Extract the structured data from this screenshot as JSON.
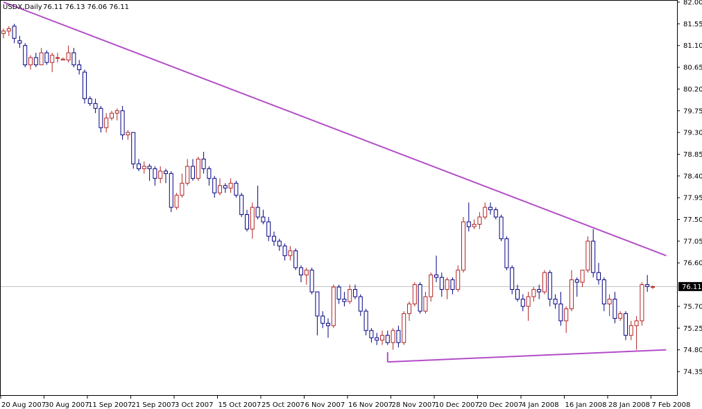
{
  "chart_data": {
    "type": "candlestick",
    "title": "USDX,Daily",
    "ohlc_header": "76.11 76.13 76.06 76.11",
    "ylim": [
      74.35,
      82.0
    ],
    "y_ticks": [
      "82.00",
      "81.55",
      "81.10",
      "80.65",
      "80.20",
      "79.75",
      "79.30",
      "78.85",
      "78.40",
      "77.95",
      "77.50",
      "77.05",
      "76.60",
      "76.11",
      "75.70",
      "75.25",
      "74.80",
      "74.35"
    ],
    "x_ticks": [
      "20 Aug 2007",
      "30 Aug 2007",
      "11 Sep 2007",
      "21 Sep 2007",
      "3 Oct 2007",
      "15 Oct 2007",
      "25 Oct 2007",
      "6 Nov 2007",
      "16 Nov 2007",
      "28 Nov 2007",
      "10 Dec 2007",
      "20 Dec 2007",
      "4 Jan 2008",
      "16 Jan 2008",
      "28 Jan 2008",
      "7 Feb 2008"
    ],
    "current_price": "76.11",
    "colors": {
      "background": "#ffffff",
      "axis": "#000000",
      "bull": "#b22222",
      "bear": "#000080",
      "trendline": "#b34dc8",
      "price_line": "#c0c0c0"
    },
    "candles": [
      [
        81.35,
        81.45,
        81.25,
        81.4
      ],
      [
        81.4,
        81.5,
        81.3,
        81.45
      ],
      [
        81.5,
        81.55,
        81.15,
        81.25
      ],
      [
        81.2,
        81.3,
        81.05,
        81.15
      ],
      [
        81.1,
        81.15,
        80.65,
        80.7
      ],
      [
        80.7,
        80.9,
        80.6,
        80.85
      ],
      [
        80.85,
        80.95,
        80.65,
        80.7
      ],
      [
        80.7,
        81.05,
        80.7,
        80.95
      ],
      [
        80.95,
        81.0,
        80.7,
        80.75
      ],
      [
        80.75,
        80.95,
        80.55,
        80.9
      ],
      [
        80.85,
        80.95,
        80.75,
        80.85
      ],
      [
        80.8,
        80.85,
        80.8,
        80.82
      ],
      [
        80.8,
        81.1,
        80.75,
        80.95
      ],
      [
        80.95,
        81.05,
        80.65,
        80.7
      ],
      [
        80.7,
        80.8,
        80.5,
        80.6
      ],
      [
        80.55,
        80.6,
        79.9,
        80.0
      ],
      [
        80.0,
        80.05,
        79.85,
        79.9
      ],
      [
        79.9,
        80.0,
        79.7,
        79.8
      ],
      [
        79.8,
        79.85,
        79.3,
        79.4
      ],
      [
        79.4,
        79.7,
        79.3,
        79.6
      ],
      [
        79.6,
        79.75,
        79.55,
        79.7
      ],
      [
        79.7,
        79.8,
        79.55,
        79.75
      ],
      [
        79.75,
        79.85,
        79.15,
        79.25
      ],
      [
        79.25,
        79.35,
        79.15,
        79.3
      ],
      [
        79.3,
        79.3,
        78.55,
        78.65
      ],
      [
        78.65,
        78.75,
        78.5,
        78.55
      ],
      [
        78.55,
        78.7,
        78.45,
        78.6
      ],
      [
        78.6,
        78.65,
        78.3,
        78.55
      ],
      [
        78.55,
        78.6,
        78.2,
        78.35
      ],
      [
        78.35,
        78.6,
        78.25,
        78.5
      ],
      [
        78.5,
        78.55,
        78.25,
        78.45
      ],
      [
        78.45,
        78.5,
        77.65,
        77.75
      ],
      [
        77.75,
        78.05,
        77.7,
        78.0
      ],
      [
        78.0,
        78.45,
        77.95,
        78.25
      ],
      [
        78.25,
        78.75,
        78.2,
        78.6
      ],
      [
        78.6,
        78.75,
        78.3,
        78.35
      ],
      [
        78.35,
        78.8,
        78.3,
        78.75
      ],
      [
        78.75,
        78.9,
        78.45,
        78.55
      ],
      [
        78.55,
        78.6,
        78.2,
        78.35
      ],
      [
        78.35,
        78.4,
        77.95,
        78.05
      ],
      [
        78.05,
        78.35,
        78.0,
        78.2
      ],
      [
        78.2,
        78.25,
        78.05,
        78.15
      ],
      [
        78.15,
        78.35,
        78.05,
        78.25
      ],
      [
        78.25,
        78.3,
        77.95,
        78.0
      ],
      [
        78.0,
        78.05,
        77.55,
        77.6
      ],
      [
        77.6,
        77.7,
        77.25,
        77.3
      ],
      [
        77.3,
        77.85,
        77.1,
        77.75
      ],
      [
        77.75,
        78.2,
        77.5,
        77.55
      ],
      [
        77.55,
        77.7,
        77.4,
        77.45
      ],
      [
        77.45,
        77.55,
        77.05,
        77.15
      ],
      [
        77.15,
        77.25,
        76.95,
        77.05
      ],
      [
        77.05,
        77.1,
        76.85,
        76.95
      ],
      [
        76.95,
        77.0,
        76.65,
        76.75
      ],
      [
        76.75,
        76.95,
        76.65,
        76.85
      ],
      [
        76.85,
        76.9,
        76.45,
        76.5
      ],
      [
        76.5,
        76.55,
        76.2,
        76.35
      ],
      [
        76.35,
        76.5,
        76.15,
        76.45
      ],
      [
        76.45,
        76.5,
        75.95,
        76.0
      ],
      [
        76.0,
        76.0,
        75.1,
        75.5
      ],
      [
        75.5,
        75.6,
        75.25,
        75.35
      ],
      [
        75.35,
        75.45,
        75.05,
        75.3
      ],
      [
        75.3,
        76.15,
        75.25,
        76.1
      ],
      [
        76.1,
        76.15,
        75.75,
        75.85
      ],
      [
        75.85,
        76.0,
        75.7,
        75.8
      ],
      [
        75.8,
        76.15,
        75.75,
        76.05
      ],
      [
        76.05,
        76.15,
        75.85,
        75.9
      ],
      [
        75.9,
        75.95,
        75.5,
        75.6
      ],
      [
        75.6,
        75.65,
        75.1,
        75.2
      ],
      [
        75.2,
        75.25,
        74.95,
        75.05
      ],
      [
        75.05,
        75.15,
        74.9,
        75.0
      ],
      [
        75.0,
        75.2,
        74.9,
        75.1
      ],
      [
        75.1,
        75.2,
        74.9,
        74.95
      ],
      [
        74.95,
        75.25,
        74.8,
        75.2
      ],
      [
        75.2,
        75.3,
        74.85,
        74.95
      ],
      [
        74.95,
        75.6,
        74.9,
        75.55
      ],
      [
        75.55,
        75.8,
        75.4,
        75.75
      ],
      [
        75.75,
        76.2,
        75.7,
        76.15
      ],
      [
        76.15,
        76.2,
        75.55,
        75.6
      ],
      [
        75.6,
        76.0,
        75.55,
        75.9
      ],
      [
        75.9,
        76.4,
        75.8,
        76.35
      ],
      [
        76.35,
        76.75,
        76.2,
        76.3
      ],
      [
        76.3,
        76.4,
        75.9,
        76.05
      ],
      [
        76.05,
        76.3,
        75.85,
        76.25
      ],
      [
        76.25,
        76.3,
        75.95,
        76.05
      ],
      [
        76.05,
        76.55,
        76.0,
        76.45
      ],
      [
        76.45,
        77.55,
        76.4,
        77.45
      ],
      [
        77.45,
        77.85,
        77.25,
        77.35
      ],
      [
        77.35,
        77.5,
        77.3,
        77.4
      ],
      [
        77.4,
        77.65,
        77.3,
        77.55
      ],
      [
        77.55,
        77.85,
        77.5,
        77.75
      ],
      [
        77.75,
        77.85,
        77.6,
        77.7
      ],
      [
        77.7,
        77.75,
        77.5,
        77.55
      ],
      [
        77.55,
        77.6,
        77.05,
        77.1
      ],
      [
        77.1,
        77.15,
        76.45,
        76.5
      ],
      [
        76.5,
        76.55,
        75.95,
        76.05
      ],
      [
        76.05,
        76.15,
        75.8,
        75.85
      ],
      [
        75.85,
        75.95,
        75.6,
        75.7
      ],
      [
        75.7,
        76.0,
        75.4,
        75.9
      ],
      [
        75.9,
        76.1,
        75.8,
        76.05
      ],
      [
        76.05,
        76.15,
        75.85,
        76.0
      ],
      [
        76.0,
        76.45,
        75.95,
        76.4
      ],
      [
        76.4,
        76.45,
        75.7,
        75.85
      ],
      [
        75.85,
        75.95,
        75.65,
        75.75
      ],
      [
        75.75,
        76.0,
        75.3,
        75.4
      ],
      [
        75.4,
        75.7,
        75.15,
        75.65
      ],
      [
        75.65,
        76.45,
        75.6,
        76.25
      ],
      [
        76.25,
        76.3,
        75.9,
        76.2
      ],
      [
        76.2,
        76.45,
        76.1,
        76.45
      ],
      [
        76.45,
        77.15,
        76.4,
        77.05
      ],
      [
        77.05,
        77.3,
        76.3,
        76.4
      ],
      [
        76.4,
        76.6,
        76.15,
        76.25
      ],
      [
        76.25,
        76.3,
        75.6,
        75.75
      ],
      [
        75.75,
        75.95,
        75.5,
        75.85
      ],
      [
        75.85,
        76.0,
        75.35,
        75.45
      ],
      [
        75.45,
        75.6,
        75.4,
        75.55
      ],
      [
        75.55,
        75.6,
        75.0,
        75.1
      ],
      [
        75.1,
        75.4,
        75.0,
        75.3
      ],
      [
        75.3,
        75.5,
        74.8,
        75.4
      ],
      [
        75.4,
        76.2,
        75.3,
        76.15
      ],
      [
        76.15,
        76.35,
        76.0,
        76.11
      ],
      [
        76.11,
        76.13,
        76.06,
        76.11
      ]
    ],
    "trendlines": [
      {
        "name": "upper",
        "from": [
          0,
          82.0
        ],
        "to": [
          122.5,
          76.75
        ]
      },
      {
        "name": "lower",
        "from": [
          71,
          74.55
        ],
        "to": [
          122.5,
          74.8
        ]
      }
    ]
  }
}
